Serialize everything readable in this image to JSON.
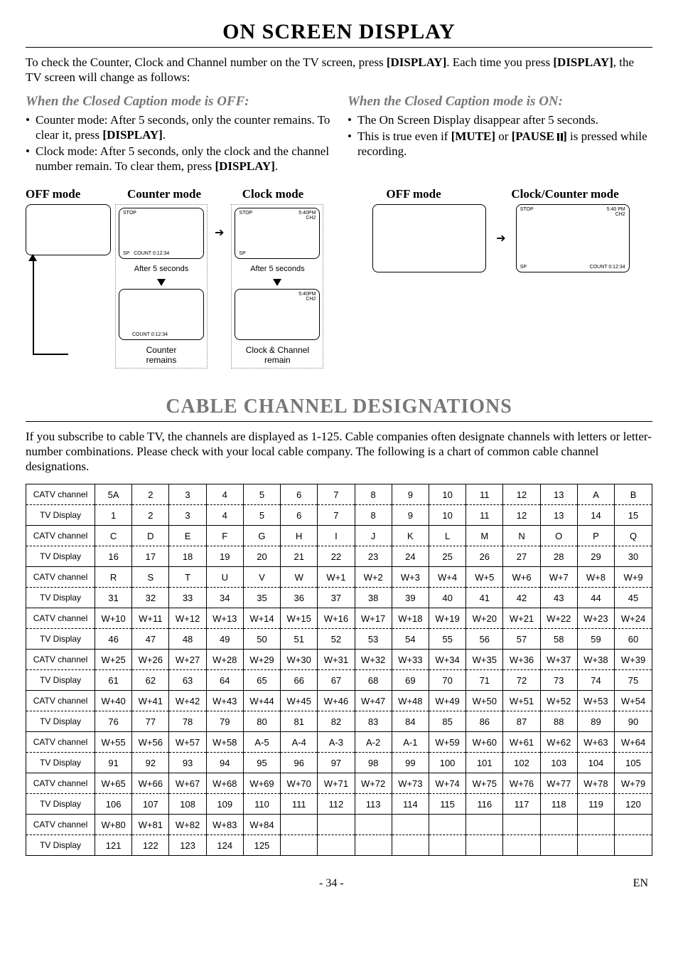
{
  "title1": "ON SCREEN DISPLAY",
  "intro1": "To check the Counter, Clock and Channel number on the TV screen, press [DISPLAY]. Each time you press [DISPLAY], the TV screen will change as follows:",
  "cc_off_head": "When the Closed Caption mode is OFF:",
  "cc_off_b1": "Counter mode: After 5 seconds, only the counter remains. To clear it, press [DISPLAY].",
  "cc_off_b2": "Clock mode: After 5 seconds, only the clock and the channel number remain. To clear them, press [DISPLAY].",
  "cc_on_head": "When the Closed Caption mode is ON:",
  "cc_on_b1": "The On Screen Display disappear after 5 seconds.",
  "cc_on_b2a": "This is true even if ",
  "cc_on_b2b": "[MUTE]",
  "cc_on_b2c": " or ",
  "cc_on_b2d": "[PAUSE ",
  "cc_on_b2e": "]",
  "cc_on_b2f": " is pressed while recording.",
  "left_labels": {
    "off": "OFF mode",
    "counter": "Counter mode",
    "clock": "Clock mode"
  },
  "right_labels": {
    "off": "OFF mode",
    "clock": "Clock/Counter mode"
  },
  "screen": {
    "stop": "STOP",
    "time": "5:40PM",
    "time_sp": "5:40 PM",
    "ch": "CH2",
    "sp": "SP",
    "count": "COUNT  0:12:34",
    "after5": "After 5 seconds",
    "counter_remains": "Counter\nremains",
    "clock_remain": "Clock & Channel\nremain"
  },
  "title2": "CABLE CHANNEL DESIGNATIONS",
  "intro2": "If you subscribe to cable TV, the channels are displayed as 1-125. Cable companies often designate channels with letters or letter-number combinations. Please check with your local cable company. The following is a chart of common cable channel designations.",
  "rowhead_catv": "CATV channel",
  "rowhead_tv": "TV Display",
  "groups": [
    {
      "catv": [
        "5A",
        "2",
        "3",
        "4",
        "5",
        "6",
        "7",
        "8",
        "9",
        "10",
        "11",
        "12",
        "13",
        "A",
        "B"
      ],
      "tv": [
        "1",
        "2",
        "3",
        "4",
        "5",
        "6",
        "7",
        "8",
        "9",
        "10",
        "11",
        "12",
        "13",
        "14",
        "15"
      ]
    },
    {
      "catv": [
        "C",
        "D",
        "E",
        "F",
        "G",
        "H",
        "I",
        "J",
        "K",
        "L",
        "M",
        "N",
        "O",
        "P",
        "Q"
      ],
      "tv": [
        "16",
        "17",
        "18",
        "19",
        "20",
        "21",
        "22",
        "23",
        "24",
        "25",
        "26",
        "27",
        "28",
        "29",
        "30"
      ]
    },
    {
      "catv": [
        "R",
        "S",
        "T",
        "U",
        "V",
        "W",
        "W+1",
        "W+2",
        "W+3",
        "W+4",
        "W+5",
        "W+6",
        "W+7",
        "W+8",
        "W+9"
      ],
      "tv": [
        "31",
        "32",
        "33",
        "34",
        "35",
        "36",
        "37",
        "38",
        "39",
        "40",
        "41",
        "42",
        "43",
        "44",
        "45"
      ]
    },
    {
      "catv": [
        "W+10",
        "W+11",
        "W+12",
        "W+13",
        "W+14",
        "W+15",
        "W+16",
        "W+17",
        "W+18",
        "W+19",
        "W+20",
        "W+21",
        "W+22",
        "W+23",
        "W+24"
      ],
      "tv": [
        "46",
        "47",
        "48",
        "49",
        "50",
        "51",
        "52",
        "53",
        "54",
        "55",
        "56",
        "57",
        "58",
        "59",
        "60"
      ]
    },
    {
      "catv": [
        "W+25",
        "W+26",
        "W+27",
        "W+28",
        "W+29",
        "W+30",
        "W+31",
        "W+32",
        "W+33",
        "W+34",
        "W+35",
        "W+36",
        "W+37",
        "W+38",
        "W+39"
      ],
      "tv": [
        "61",
        "62",
        "63",
        "64",
        "65",
        "66",
        "67",
        "68",
        "69",
        "70",
        "71",
        "72",
        "73",
        "74",
        "75"
      ]
    },
    {
      "catv": [
        "W+40",
        "W+41",
        "W+42",
        "W+43",
        "W+44",
        "W+45",
        "W+46",
        "W+47",
        "W+48",
        "W+49",
        "W+50",
        "W+51",
        "W+52",
        "W+53",
        "W+54"
      ],
      "tv": [
        "76",
        "77",
        "78",
        "79",
        "80",
        "81",
        "82",
        "83",
        "84",
        "85",
        "86",
        "87",
        "88",
        "89",
        "90"
      ]
    },
    {
      "catv": [
        "W+55",
        "W+56",
        "W+57",
        "W+58",
        "A-5",
        "A-4",
        "A-3",
        "A-2",
        "A-1",
        "W+59",
        "W+60",
        "W+61",
        "W+62",
        "W+63",
        "W+64"
      ],
      "tv": [
        "91",
        "92",
        "93",
        "94",
        "95",
        "96",
        "97",
        "98",
        "99",
        "100",
        "101",
        "102",
        "103",
        "104",
        "105"
      ]
    },
    {
      "catv": [
        "W+65",
        "W+66",
        "W+67",
        "W+68",
        "W+69",
        "W+70",
        "W+71",
        "W+72",
        "W+73",
        "W+74",
        "W+75",
        "W+76",
        "W+77",
        "W+78",
        "W+79"
      ],
      "tv": [
        "106",
        "107",
        "108",
        "109",
        "110",
        "111",
        "112",
        "113",
        "114",
        "115",
        "116",
        "117",
        "118",
        "119",
        "120"
      ]
    },
    {
      "catv": [
        "W+80",
        "W+81",
        "W+82",
        "W+83",
        "W+84",
        "",
        "",
        "",
        "",
        "",
        "",
        "",
        "",
        "",
        ""
      ],
      "tv": [
        "121",
        "122",
        "123",
        "124",
        "125",
        "",
        "",
        "",
        "",
        "",
        "",
        "",
        "",
        "",
        ""
      ]
    }
  ],
  "footer": {
    "page": "- 34 -",
    "lang": "EN"
  }
}
